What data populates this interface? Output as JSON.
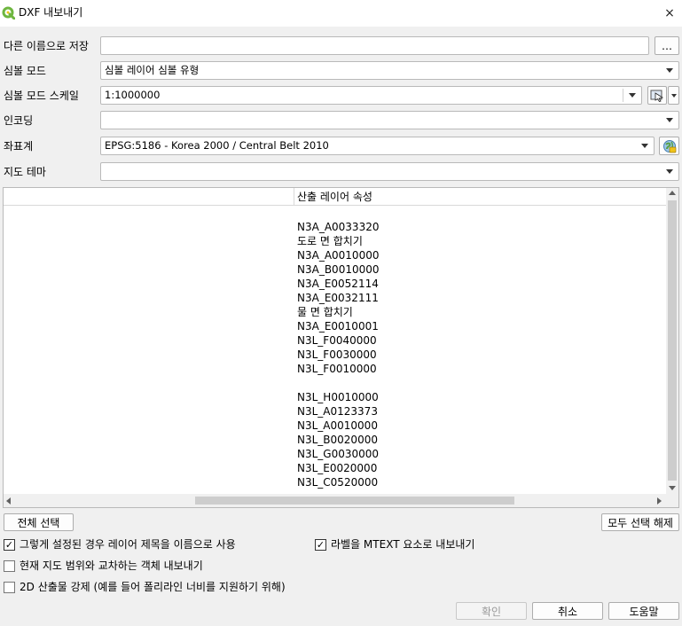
{
  "window": {
    "title": "DXF 내보내기",
    "close_icon": "×"
  },
  "form": {
    "save_as_label": "다른 이름으로 저장",
    "save_as_value": "",
    "browse_label": "…",
    "symbology_mode_label": "심볼 모드",
    "symbology_mode_value": "심볼 레이어 심볼 유형",
    "symbology_scale_label": "심볼 모드 스케일",
    "symbology_scale_value": "1:1000000",
    "encoding_label": "인코딩",
    "encoding_value": "",
    "crs_label": "좌표계",
    "crs_value": "EPSG:5186 - Korea 2000 / Central Belt 2010",
    "map_theme_label": "지도 테마",
    "map_theme_value": ""
  },
  "layers": {
    "column_header": "산출 레이어 속성",
    "items": [
      "N3A_A0033320",
      "도로 면 합치기",
      "N3A_A0010000",
      "N3A_B0010000",
      "N3A_E0052114",
      "N3A_E0032111",
      "물 면 합치기",
      "N3A_E0010001",
      "N3L_F0040000",
      "N3L_F0030000",
      "N3L_F0010000",
      "",
      "N3L_H0010000",
      "N3L_A0123373",
      "N3L_A0010000",
      "N3L_B0020000",
      "N3L_G0030000",
      "N3L_E0020000",
      "N3L_C0520000"
    ]
  },
  "selection": {
    "select_all": "전체 선택",
    "deselect_all": "모두 선택 해제"
  },
  "options": {
    "use_layer_title": {
      "label": "그렇게 설정된 경우 레이어 제목을 이름으로 사용",
      "checked": true
    },
    "export_labels_mtext": {
      "label": "라벨을 MTEXT 요소로 내보내기",
      "checked": true
    },
    "intersecting_only": {
      "label": "현재 지도 범위와 교차하는 객체 내보내기",
      "checked": false
    },
    "force_2d": {
      "label": "2D 산출물 강제 (예를 들어 폴리라인 너비를 지원하기 위해)",
      "checked": false
    }
  },
  "footer": {
    "ok": "확인",
    "cancel": "취소",
    "help": "도움말"
  },
  "colors": {
    "qgis_green": "#6eb63f",
    "qgis_yellow": "#f0c419"
  }
}
